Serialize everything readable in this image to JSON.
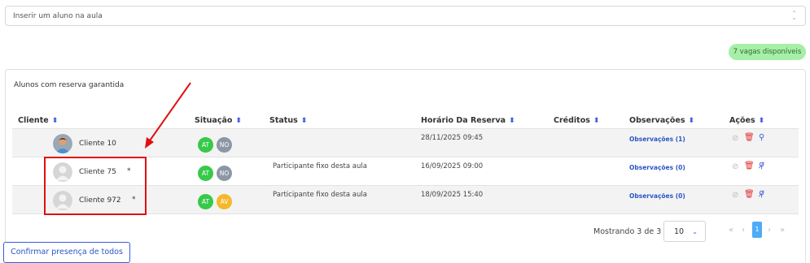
{
  "student_select": {
    "placeholder": "Inserir um aluno na aula",
    "updown_icon": "⬍"
  },
  "vagas": {
    "label": "7 vagas disponíveis",
    "color": "#a6efa6"
  },
  "panel": {
    "title": "Alunos com reserva garantida",
    "columns": {
      "cliente": "Cliente",
      "situacao": "Situação",
      "status": "Status",
      "horario": "Horário Da Reserva",
      "creditos": "Créditos",
      "observacoes": "Observações",
      "acoes": "Ações"
    },
    "sort_icon": "⬍"
  },
  "rows": [
    {
      "name": "Cliente 10",
      "asterisk": "",
      "badges": [
        "AT",
        "NO"
      ],
      "status": "",
      "horario": "28/11/2025 09:45",
      "observacoes": "Observações (1)",
      "pin_icon": "ꟼ",
      "pin_icon_name": "pin-icon"
    },
    {
      "name": "Cliente 75",
      "asterisk": "*",
      "badges": [
        "AT",
        "NO"
      ],
      "status": "Participante fixo desta aula",
      "horario": "16/09/2025 09:00",
      "observacoes": "Observações (0)",
      "pin_icon": "⊘",
      "pin_icon_name": "unpin-icon"
    },
    {
      "name": "Cliente 972",
      "asterisk": "*",
      "badges": [
        "AT",
        "AV"
      ],
      "status": "Participante fixo desta aula",
      "horario": "18/09/2025 15:40",
      "observacoes": "Observações (0)",
      "pin_icon": "⊘",
      "pin_icon_name": "unpin-icon"
    }
  ],
  "action_icons": {
    "check": "⊘",
    "trash": "🗑"
  },
  "pagination": {
    "summary": "Mostrando 3 de 3",
    "page_size": "10",
    "first": "«",
    "prev": "‹",
    "current": "1",
    "next": "›",
    "last": "»"
  },
  "confirm_button": "Confirmar presença de todos",
  "colors": {
    "accent": "#3b5bdb",
    "danger": "#e03131",
    "badge_at": "#37c94a",
    "badge_no": "#8c97a6",
    "badge_av": "#f5b82a",
    "annotation": "#e01010"
  }
}
